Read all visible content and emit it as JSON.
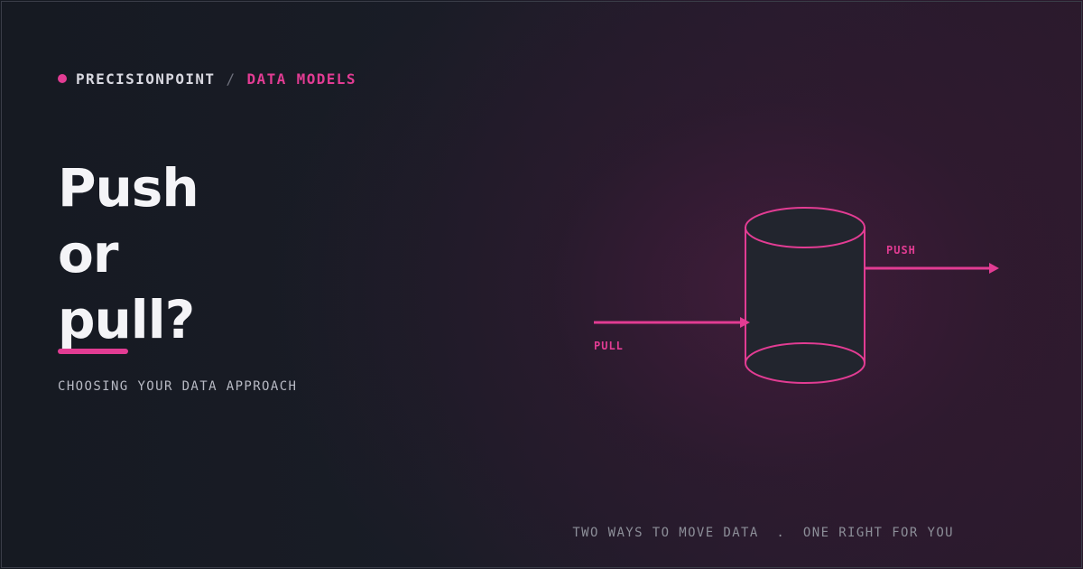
{
  "brand": {
    "name": "PRECISIONPOINT",
    "separator": "/",
    "section": "DATA MODELS"
  },
  "headline": {
    "line1": "Push",
    "line2": "or",
    "line3": "pull?"
  },
  "subtitle": "CHOOSING YOUR DATA APPROACH",
  "diagram": {
    "push_label": "PUSH",
    "pull_label": "PULL",
    "icon": "database-cylinder-icon"
  },
  "footer": {
    "left": "TWO WAYS TO MOVE DATA",
    "separator": ".",
    "right": "ONE RIGHT FOR YOU"
  },
  "colors": {
    "accent": "#e23c93",
    "background": "#171b24",
    "text": "#f4f4f7"
  }
}
